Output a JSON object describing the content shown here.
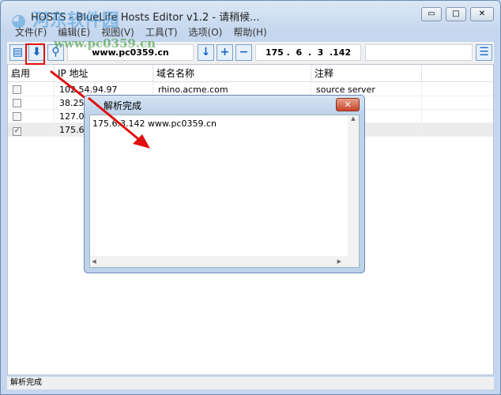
{
  "window": {
    "title": "HOSTS - BlueLife Hosts Editor v1.2 - 请稍候...",
    "minimize": "▭",
    "maximize": "□",
    "close": "✕"
  },
  "menu": [
    "文件(F)",
    "编辑(E)",
    "视图(V)",
    "工具(T)",
    "选项(O)",
    "帮助(H)"
  ],
  "toolbar": {
    "domain": "www.pc0359.cn",
    "ip": "175 .  6  .  3  .142",
    "comment": ""
  },
  "columns": [
    "启用",
    "IP 地址",
    "域名名称",
    "注释"
  ],
  "rows": [
    {
      "checked": false,
      "ip": "102.54.94.97",
      "domain": "rhino.acme.com",
      "comment": "source server"
    },
    {
      "checked": false,
      "ip": "38.25.",
      "domain": "",
      "comment": ""
    },
    {
      "checked": false,
      "ip": "127.0.",
      "domain": "",
      "comment": ""
    },
    {
      "checked": true,
      "ip": "175.6.",
      "domain": "",
      "comment": ""
    }
  ],
  "dialog": {
    "title": "解析完成",
    "content": "175.6.3.142 www.pc0359.cn",
    "close": "✕"
  },
  "status": "解析完成",
  "watermark": {
    "name": "河东软件园",
    "url": "www.pc0359.cn"
  }
}
